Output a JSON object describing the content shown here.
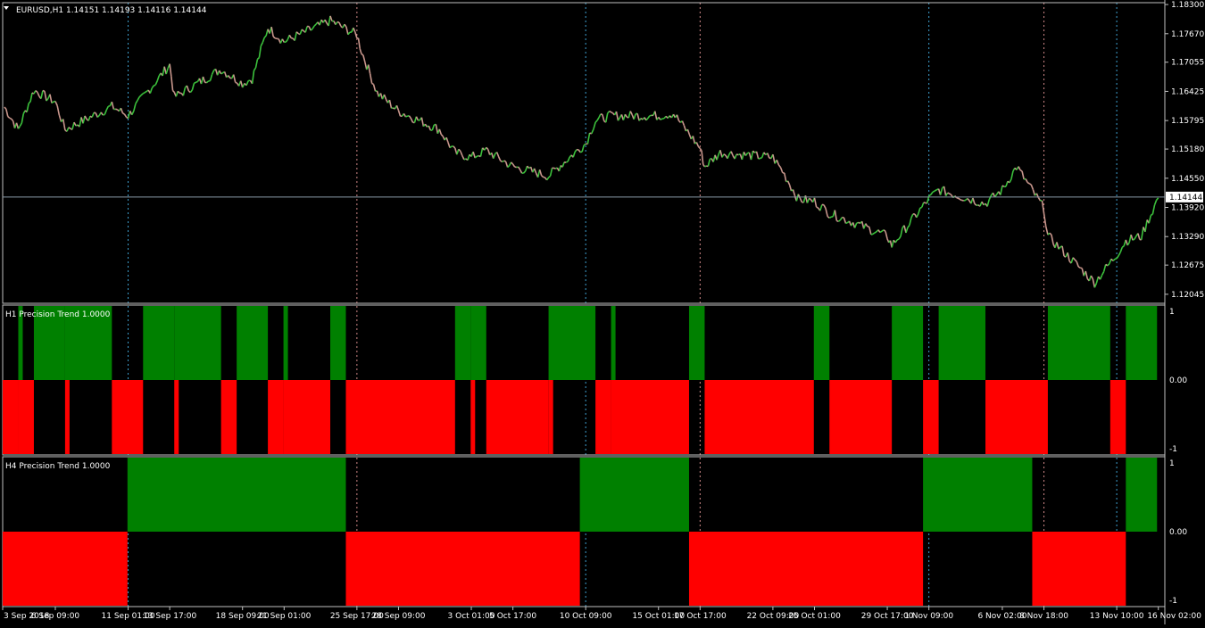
{
  "colors": {
    "background": "#000000",
    "frame": "#c0c0c0",
    "bull_candle": "#3cc13c",
    "bear_candle": "#c8968c",
    "trend_up": "#008000",
    "trend_down": "#ff0000",
    "h1_separator": "#3fa0d0",
    "h4_separator": "#d08888",
    "bid_line": "#8a9aa8",
    "text": "#ffffff"
  },
  "main": {
    "title": "EURUSD,H1  1.14151 1.14193 1.14116 1.14144",
    "price_min": 1.1185,
    "price_max": 1.1834,
    "price_labels": [
      "1.18300",
      "1.17670",
      "1.17055",
      "1.16425",
      "1.15795",
      "1.15180",
      "1.14550",
      "1.13920",
      "1.13290",
      "1.12675",
      "1.12045"
    ],
    "current_price": 1.14144,
    "current_price_label": "1.14144"
  },
  "sub1": {
    "title": "H1 Precision Trend 1.0000",
    "labels": [
      "1",
      "0.00",
      "-1"
    ]
  },
  "sub2": {
    "title": "H4 Precision Trend 1.0000",
    "labels": [
      "1",
      "0.00",
      "-1"
    ]
  },
  "time_labels": [
    "3 Sep 2018",
    "6 Sep 09:00",
    "11 Sep 01:00",
    "13 Sep 17:00",
    "18 Sep 09:00",
    "21 Sep 01:00",
    "25 Sep 17:00",
    "28 Sep 09:00",
    "3 Oct 01:00",
    "5 Oct 17:00",
    "10 Oct 09:00",
    "15 Oct 01:00",
    "17 Oct 17:00",
    "22 Oct 09:00",
    "25 Oct 01:00",
    "29 Oct 17:00",
    "1 Nov 09:00",
    "6 Nov 02:00",
    "8 Nov 18:00",
    "13 Nov 10:00",
    "16 Nov 02:00"
  ],
  "chart_data": {
    "type": "line",
    "series": [
      {
        "name": "EURUSD,H1",
        "points": [
          {
            "x": "3 Sep 2018",
            "y": 1.1615
          },
          {
            "x": "4 Sep 2018",
            "y": 1.156
          },
          {
            "x": "5 Sep 2018",
            "y": 1.1645
          },
          {
            "x": "6 Sep 09:00",
            "y": 1.162
          },
          {
            "x": "7 Sep 2018",
            "y": 1.156
          },
          {
            "x": "10 Sep 2018",
            "y": 1.161
          },
          {
            "x": "11 Sep 01:00",
            "y": 1.159
          },
          {
            "x": "12 Sep 2018",
            "y": 1.163
          },
          {
            "x": "13 Sep 17:00",
            "y": 1.17
          },
          {
            "x": "14 Sep 2018",
            "y": 1.163
          },
          {
            "x": "17 Sep 2018",
            "y": 1.169
          },
          {
            "x": "18 Sep 09:00",
            "y": 1.166
          },
          {
            "x": "19 Sep 2018",
            "y": 1.167
          },
          {
            "x": "20 Sep 2018",
            "y": 1.178
          },
          {
            "x": "21 Sep 01:00",
            "y": 1.175
          },
          {
            "x": "24 Sep 2018",
            "y": 1.1795
          },
          {
            "x": "25 Sep 17:00",
            "y": 1.1765
          },
          {
            "x": "26 Sep 2018",
            "y": 1.173
          },
          {
            "x": "27 Sep 2018",
            "y": 1.164
          },
          {
            "x": "28 Sep 09:00",
            "y": 1.16
          },
          {
            "x": "1 Oct 2018",
            "y": 1.156
          },
          {
            "x": "2 Oct 2018",
            "y": 1.151
          },
          {
            "x": "3 Oct 01:00",
            "y": 1.15
          },
          {
            "x": "4 Oct 2018",
            "y": 1.1515
          },
          {
            "x": "5 Oct 17:00",
            "y": 1.148
          },
          {
            "x": "8 Oct 2018",
            "y": 1.146
          },
          {
            "x": "9 Oct 2018",
            "y": 1.149
          },
          {
            "x": "10 Oct 09:00",
            "y": 1.153
          },
          {
            "x": "11 Oct 2018",
            "y": 1.158
          },
          {
            "x": "12 Oct 2018",
            "y": 1.159
          },
          {
            "x": "15 Oct 01:00",
            "y": 1.159
          },
          {
            "x": "16 Oct 2018",
            "y": 1.1595
          },
          {
            "x": "17 Oct 17:00",
            "y": 1.152
          },
          {
            "x": "18 Oct 2018",
            "y": 1.148
          },
          {
            "x": "19 Oct 2018",
            "y": 1.151
          },
          {
            "x": "22 Oct 09:00",
            "y": 1.15
          },
          {
            "x": "23 Oct 2018",
            "y": 1.147
          },
          {
            "x": "24 Oct 2018",
            "y": 1.141
          },
          {
            "x": "25 Oct 01:00",
            "y": 1.1405
          },
          {
            "x": "26 Oct 2018",
            "y": 1.138
          },
          {
            "x": "29 Oct 17:00",
            "y": 1.133
          },
          {
            "x": "30 Oct 2018",
            "y": 1.131
          },
          {
            "x": "1 Nov 09:00",
            "y": 1.141
          },
          {
            "x": "2 Nov 2018",
            "y": 1.143
          },
          {
            "x": "5 Nov 2018",
            "y": 1.14
          },
          {
            "x": "6 Nov 02:00",
            "y": 1.143
          },
          {
            "x": "7 Nov 2018",
            "y": 1.148
          },
          {
            "x": "8 Nov 18:00",
            "y": 1.139
          },
          {
            "x": "9 Nov 2018",
            "y": 1.133
          },
          {
            "x": "12 Nov 2018",
            "y": 1.123
          },
          {
            "x": "13 Nov 10:00",
            "y": 1.129
          },
          {
            "x": "14 Nov 2018",
            "y": 1.132
          },
          {
            "x": "15 Nov 2018",
            "y": 1.133
          },
          {
            "x": "16 Nov 02:00",
            "y": 1.1414
          }
        ]
      }
    ],
    "trend_blocks": [
      {
        "name": "H1 Precision Trend",
        "blocks": [
          {
            "from": "3 Sep 2018",
            "to": "4 Sep 2018",
            "value": -1
          },
          {
            "from": "4 Sep 2018",
            "to": "4 Sep 2018",
            "value": 1
          },
          {
            "from": "4 Sep 2018",
            "to": "5 Sep 2018",
            "value": -1
          },
          {
            "from": "5 Sep 2018",
            "to": "7 Sep 2018",
            "value": 1
          },
          {
            "from": "7 Sep 2018",
            "to": "7 Sep 2018",
            "value": -1
          },
          {
            "from": "7 Sep 2018",
            "to": "10 Sep 2018",
            "value": 1
          },
          {
            "from": "10 Sep 2018",
            "to": "12 Sep 2018",
            "value": -1
          },
          {
            "from": "12 Sep 2018",
            "to": "14 Sep 2018",
            "value": 1
          },
          {
            "from": "14 Sep 2018",
            "to": "14 Sep 2018",
            "value": -1
          },
          {
            "from": "14 Sep 2018",
            "to": "17 Sep 2018",
            "value": 1
          },
          {
            "from": "17 Sep 2018",
            "to": "18 Sep 2018",
            "value": -1
          },
          {
            "from": "18 Sep 2018",
            "to": "20 Sep 2018",
            "value": 1
          },
          {
            "from": "20 Sep 2018",
            "to": "21 Sep 2018",
            "value": -1
          },
          {
            "from": "21 Sep 2018",
            "to": "21 Sep 2018",
            "value": 1
          },
          {
            "from": "21 Sep 2018",
            "to": "24 Sep 2018",
            "value": -1
          },
          {
            "from": "24 Sep 2018",
            "to": "25 Sep 2018",
            "value": 1
          },
          {
            "from": "25 Sep 2018",
            "to": "2 Oct 2018",
            "value": -1
          },
          {
            "from": "2 Oct 2018",
            "to": "3 Oct 2018",
            "value": 1
          },
          {
            "from": "3 Oct 2018",
            "to": "3 Oct 2018",
            "value": -1
          },
          {
            "from": "3 Oct 2018",
            "to": "4 Oct 2018",
            "value": 1
          },
          {
            "from": "4 Oct 2018",
            "to": "8 Oct 2018",
            "value": -1
          },
          {
            "from": "8 Oct 2018",
            "to": "8 Oct 2018",
            "value": 1
          },
          {
            "from": "8 Oct 2018",
            "to": "8 Oct 2018",
            "value": -1
          },
          {
            "from": "8 Oct 2018",
            "to": "11 Oct 2018",
            "value": 1
          },
          {
            "from": "11 Oct 2018",
            "to": "12 Oct 2018",
            "value": -1
          },
          {
            "from": "12 Oct 2018",
            "to": "12 Oct 2018",
            "value": 1
          },
          {
            "from": "12 Oct 2018",
            "to": "17 Oct 2018",
            "value": -1
          },
          {
            "from": "17 Oct 2018",
            "to": "18 Oct 2018",
            "value": 1
          },
          {
            "from": "18 Oct 2018",
            "to": "25 Oct 2018",
            "value": -1
          },
          {
            "from": "25 Oct 2018",
            "to": "26 Oct 2018",
            "value": 1
          },
          {
            "from": "26 Oct 2018",
            "to": "30 Oct 2018",
            "value": -1
          },
          {
            "from": "30 Oct 2018",
            "to": "1 Nov 2018",
            "value": 1
          },
          {
            "from": "1 Nov 2018",
            "to": "2 Nov 2018",
            "value": -1
          },
          {
            "from": "2 Nov 2018",
            "to": "5 Nov 2018",
            "value": 1
          },
          {
            "from": "5 Nov 2018",
            "to": "9 Nov 2018",
            "value": -1
          },
          {
            "from": "9 Nov 2018",
            "to": "13 Nov 2018",
            "value": 1
          },
          {
            "from": "13 Nov 2018",
            "to": "14 Nov 2018",
            "value": -1
          },
          {
            "from": "14 Nov 2018",
            "to": "16 Nov 2018",
            "value": 1
          }
        ]
      },
      {
        "name": "H4 Precision Trend",
        "blocks": [
          {
            "from": "3 Sep 2018",
            "to": "11 Sep 2018",
            "value": -1
          },
          {
            "from": "11 Sep 2018",
            "to": "25 Sep 2018",
            "value": 1
          },
          {
            "from": "25 Sep 2018",
            "to": "10 Oct 2018",
            "value": -1
          },
          {
            "from": "10 Oct 2018",
            "to": "17 Oct 2018",
            "value": 1
          },
          {
            "from": "17 Oct 2018",
            "to": "1 Nov 2018",
            "value": -1
          },
          {
            "from": "1 Nov 2018",
            "to": "8 Nov 2018",
            "value": 1
          },
          {
            "from": "8 Nov 2018",
            "to": "14 Nov 2018",
            "value": -1
          },
          {
            "from": "14 Nov 2018",
            "to": "16 Nov 2018",
            "value": 1
          }
        ]
      }
    ]
  }
}
